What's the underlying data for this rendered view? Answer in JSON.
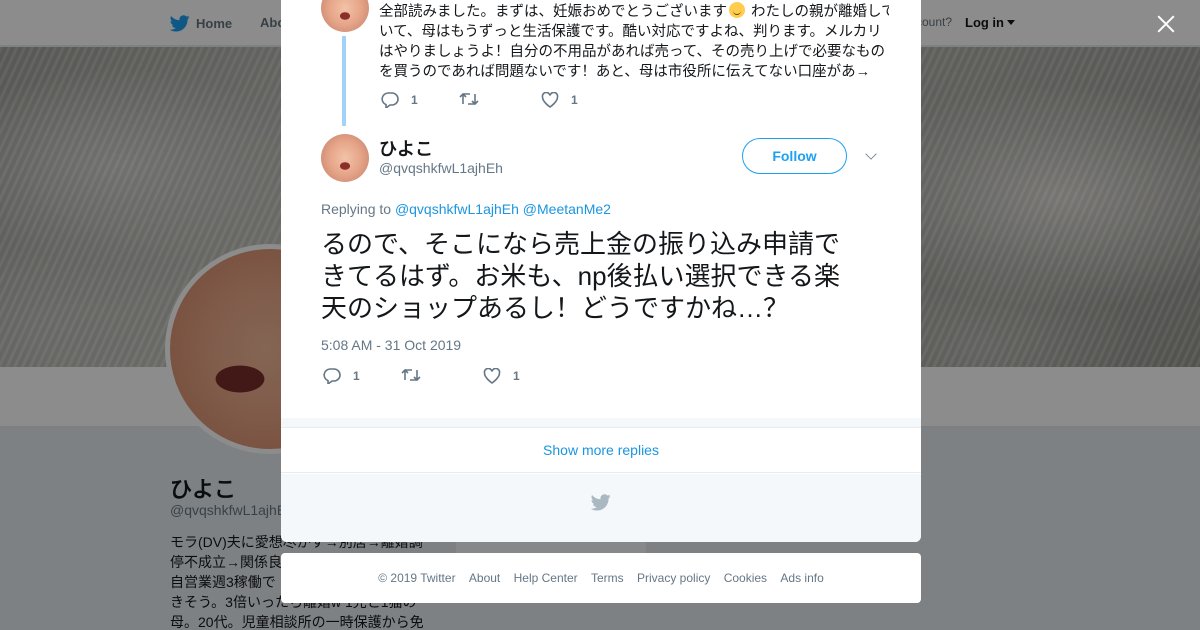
{
  "nav": {
    "home": "Home",
    "about": "Abo",
    "account": "ccount?",
    "login": "Log in"
  },
  "profile": {
    "name": "ひよこ",
    "handle": "@qvqshkfwL1ajhE",
    "bio": [
      "モラ(DV)夫に愛想尽かす→別居→離婚調",
      "停不成立→関係良",
      "自営業週3稼働で",
      "きそう。3倍いったら離婚w 1児と1猫の",
      "母。20代。児童相談所の一時保護から免"
    ]
  },
  "prev_tweet": {
    "lines": [
      {
        "before": "全部読みました。まずは、妊娠おめでとうございます",
        "emoji": "smiling-face-emoji",
        "after": " わたしの親が離婚して"
      },
      {
        "before": "いて、母はもうずっと生活保護です。酷い対応ですよね、判ります。メルカリ"
      },
      {
        "before": "はやりましょうよ！自分の不用品があれば売って、その売り上げで必要なもの"
      },
      {
        "before": "を買うのであれば問題ないです！あと、母は市役所に伝えてない口座があ→"
      }
    ],
    "reply_count": "1",
    "retweet_count": "",
    "like_count": "1"
  },
  "main_tweet": {
    "author_name": "ひよこ",
    "author_handle": "@qvqshkfwL1ajhEh",
    "follow_label": "Follow",
    "replying_label": "Replying to",
    "mentions": [
      "@qvqshkfwL1ajhEh",
      "@MeetanMe2"
    ],
    "text_lines": [
      "るので、そこになら売上金の振り込み申請で",
      "きてるはず。お米も、np後払い選択できる楽",
      "天のショップあるし！どうですかね…？"
    ],
    "timestamp": "5:08 AM - 31 Oct 2019",
    "reply_count": "1",
    "retweet_count": "",
    "like_count": "1"
  },
  "show_more_label": "Show more replies",
  "footer": {
    "links": [
      "© 2019 Twitter",
      "About",
      "Help Center",
      "Terms",
      "Privacy policy",
      "Cookies",
      "Ads info"
    ]
  },
  "colors": {
    "brand": "#1da1f2",
    "link": "#1b95e0",
    "muted": "#657786",
    "thread_line": "#a2d2f7"
  }
}
